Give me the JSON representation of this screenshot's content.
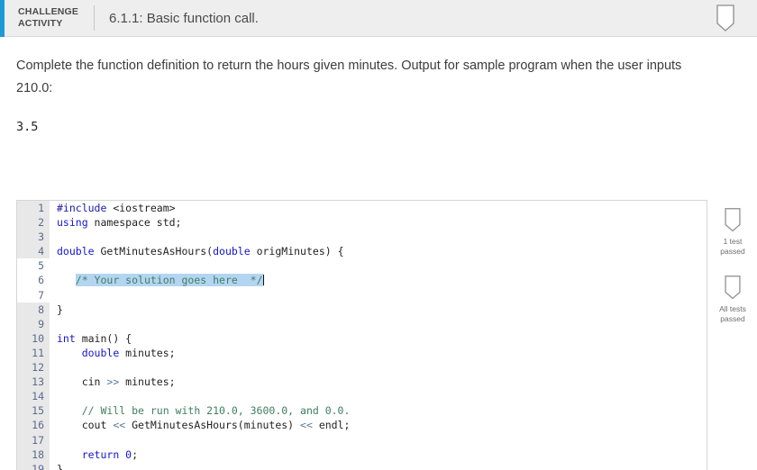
{
  "header": {
    "activity_label_line1": "CHALLENGE",
    "activity_label_line2": "ACTIVITY",
    "title": "6.1.1: Basic function call.",
    "badge_icon": "ribbon-bookmark-icon",
    "accent_color": "#1c9ad6",
    "background_color": "#eeeeee"
  },
  "prompt": {
    "text": "Complete the function definition to return the hours given minutes. Output for sample program when the user inputs 210.0:",
    "sample_output": "3.5"
  },
  "editor": {
    "line_numbers": [
      "1",
      "2",
      "3",
      "4",
      "5",
      "6",
      "7",
      "8",
      "9",
      "10",
      "11",
      "12",
      "13",
      "14",
      "15",
      "16",
      "17",
      "18",
      "19"
    ],
    "lines": [
      {
        "n": "1",
        "text": "#include <iostream>"
      },
      {
        "n": "2",
        "text": "using namespace std;"
      },
      {
        "n": "3",
        "text": ""
      },
      {
        "n": "4",
        "text": "double GetMinutesAsHours(double origMinutes) {"
      },
      {
        "n": "5",
        "text": ""
      },
      {
        "n": "6",
        "text": "   /* Your solution goes here  */"
      },
      {
        "n": "7",
        "text": ""
      },
      {
        "n": "8",
        "text": "}"
      },
      {
        "n": "9",
        "text": ""
      },
      {
        "n": "10",
        "text": "int main() {"
      },
      {
        "n": "11",
        "text": "   double minutes;"
      },
      {
        "n": "12",
        "text": ""
      },
      {
        "n": "13",
        "text": "   cin >> minutes;"
      },
      {
        "n": "14",
        "text": ""
      },
      {
        "n": "15",
        "text": "   // Will be run with 210.0, 3600.0, and 0.0."
      },
      {
        "n": "16",
        "text": "   cout << GetMinutesAsHours(minutes) << endl;"
      },
      {
        "n": "17",
        "text": ""
      },
      {
        "n": "18",
        "text": "   return 0;"
      },
      {
        "n": "19",
        "text": "}"
      }
    ],
    "tokens": {
      "l1_include": "#include",
      "l1_header": " <iostream>",
      "l2_using": "using",
      "l2_rest": " namespace std;",
      "l4_double": "double",
      "l4_name": " GetMinutesAsHours(",
      "l4_double2": "double",
      "l4_rest": " origMinutes) {",
      "l6_indent": "   ",
      "l6_comment": "/* Your solution goes here  */",
      "l8_brace": "}",
      "l10_int": "int",
      "l10_rest": " main() {",
      "l11_indent": "    ",
      "l11_double": "double",
      "l11_rest": " minutes;",
      "l13_cin": "    cin ",
      "l13_op": ">>",
      "l13_rest": " minutes;",
      "l15_comment": "    // Will be run with 210.0, 3600.0, and 0.0.",
      "l16_cout": "    cout ",
      "l16_op1": "<<",
      "l16_call": " GetMinutesAsHours(minutes) ",
      "l16_op2": "<<",
      "l16_endl": " endl;",
      "l18_indent": "    ",
      "l18_return": "return",
      "l18_zero": " 0",
      "l18_semi": ";",
      "l19_brace": "}"
    },
    "selection_color": "#b4d5f2",
    "gutter_color": "#e8e8e8"
  },
  "rail": {
    "items": [
      {
        "icon": "ribbon-bookmark-icon",
        "caption_line1": "1 test",
        "caption_line2": "passed"
      },
      {
        "icon": "ribbon-bookmark-icon",
        "caption_line1": "All tests",
        "caption_line2": "passed"
      }
    ]
  }
}
